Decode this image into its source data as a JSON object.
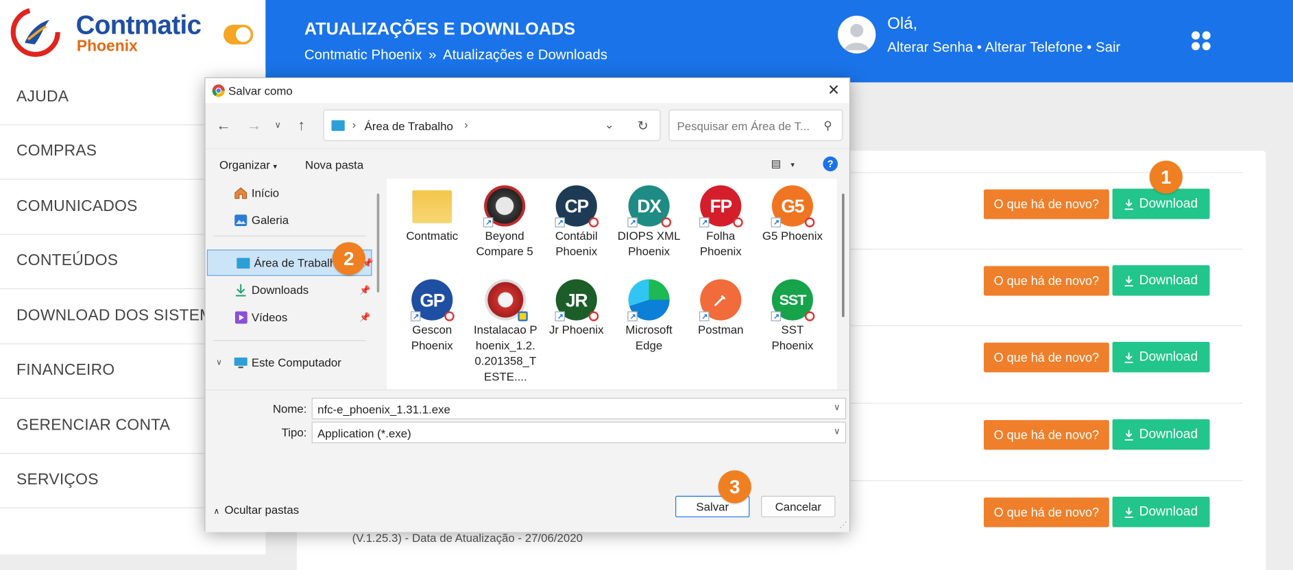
{
  "logo": {
    "brand": "Contmatic",
    "sub": "Phoenix"
  },
  "header": {
    "title": "ATUALIZAÇÕES E DOWNLOADS",
    "breadcrumb": [
      "Contmatic Phoenix",
      "»",
      "Atualizações e Downloads"
    ],
    "greeting": "Olá,",
    "account_links": "Alterar Senha • Alterar Telefone • Sair"
  },
  "sidebar": {
    "items": [
      {
        "label": "AJUDA"
      },
      {
        "label": "COMPRAS"
      },
      {
        "label": "COMUNICADOS"
      },
      {
        "label": "CONTEÚDOS"
      },
      {
        "label": "DOWNLOAD DOS SISTEMAS"
      },
      {
        "label": "FINANCEIRO"
      },
      {
        "label": "GERENCIAR CONTA"
      },
      {
        "label": "SERVIÇOS"
      }
    ]
  },
  "downloads": {
    "rows": [
      {
        "news_label": "O que há de novo?",
        "download_label": "Download"
      },
      {
        "news_label": "O que há de novo?",
        "download_label": "Download"
      },
      {
        "news_label": "O que há de novo?",
        "download_label": "Download"
      },
      {
        "news_label": "O que há de novo?",
        "download_label": "Download"
      },
      {
        "news_label": "O que há de novo?",
        "download_label": "Download"
      }
    ],
    "last_row_info": "(V.1.25.3) - Data de Atualização - 27/06/2020"
  },
  "badges": [
    "1",
    "2",
    "3"
  ],
  "dialog": {
    "title": "Salvar como",
    "address": "Área de Trabalho",
    "search_placeholder": "Pesquisar em Área de T...",
    "toolbar": {
      "organize": "Organizar",
      "new_folder": "Nova pasta"
    },
    "nav_pane": {
      "items": [
        {
          "label": "Início"
        },
        {
          "label": "Galeria"
        },
        {
          "label": "Área de Trabalho"
        },
        {
          "label": "Downloads"
        },
        {
          "label": "Vídeos"
        },
        {
          "label": "Este Computador"
        }
      ]
    },
    "files": [
      {
        "name": "Contmatic",
        "icon": "folder-icon"
      },
      {
        "name": "Beyond Compare 5",
        "icon": "beyond-compare-icon"
      },
      {
        "name": "Contábil Phoenix",
        "icon": "contabil-phoenix-icon",
        "abbr": "CP"
      },
      {
        "name": "DIOPS XML Phoenix",
        "icon": "diops-xml-phoenix-icon",
        "abbr": "DX"
      },
      {
        "name": "Folha Phoenix",
        "icon": "folha-phoenix-icon",
        "abbr": "FP"
      },
      {
        "name": "G5 Phoenix",
        "icon": "g5-phoenix-icon",
        "abbr": "G5"
      },
      {
        "name": "Gescon Phoenix",
        "icon": "gescon-phoenix-icon",
        "abbr": "GP"
      },
      {
        "name": "Instalacao Phoenix_1.2.0.201358_TESTE....",
        "icon": "installer-icon"
      },
      {
        "name": "Jr Phoenix",
        "icon": "jr-phoenix-icon",
        "abbr": "JR"
      },
      {
        "name": "Microsoft Edge",
        "icon": "edge-icon"
      },
      {
        "name": "Postman",
        "icon": "postman-icon"
      },
      {
        "name": "SST Phoenix",
        "icon": "sst-phoenix-icon",
        "abbr": "SST"
      }
    ],
    "fields": {
      "name_label": "Nome:",
      "name_value": "nfc-e_phoenix_1.31.1.exe",
      "type_label": "Tipo:",
      "type_value": "Application (*.exe)"
    },
    "hide_folders": "Ocultar pastas",
    "save": "Salvar",
    "cancel": "Cancelar"
  },
  "colors": {
    "topbar": "#1a73e8",
    "news_button": "#ef7f2a",
    "download_button": "#22c58b",
    "badge": "#f07f22"
  }
}
